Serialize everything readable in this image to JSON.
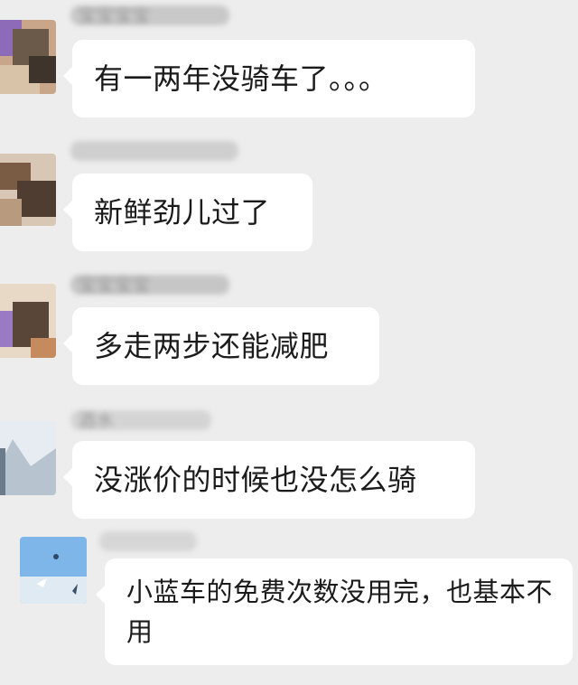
{
  "chat": {
    "messages": [
      {
        "sender": "宝宝宝宝",
        "text": "有一两年没骑车了。。。"
      },
      {
        "sender": "",
        "text": "新鲜劲儿过了"
      },
      {
        "sender": "宝宝宝宝",
        "text": "多走两步还能减肥"
      },
      {
        "sender": "酒水",
        "text": "没涨价的时候也没怎么骑"
      },
      {
        "sender": "",
        "text": "小蓝车的免费次数没用完，也基本不用"
      }
    ]
  },
  "colors": {
    "background": "#ededed",
    "bubble": "#ffffff",
    "text": "#1b1b1b"
  }
}
